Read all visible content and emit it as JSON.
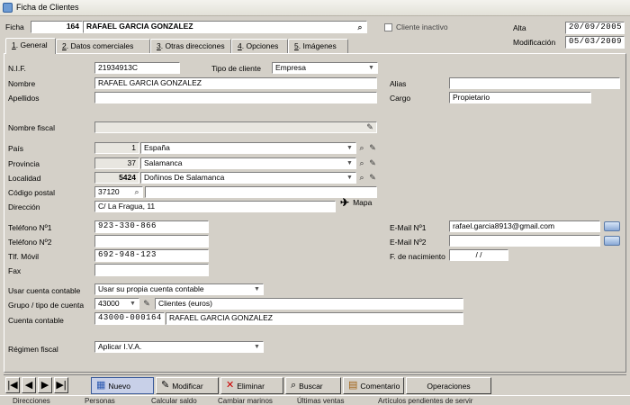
{
  "window": {
    "title": "Ficha de Clientes"
  },
  "header": {
    "ficha_label": "Ficha",
    "ficha_number": "164",
    "client_name": "RAFAEL GARCIA GONZALEZ",
    "inactive_label": "Cliente inactivo",
    "alta_label": "Alta",
    "alta_value": "20/09/2005",
    "modificacion_label": "Modificación",
    "modificacion_value": "05/03/2009"
  },
  "tabs": [
    {
      "key": "1",
      "label": ". General"
    },
    {
      "key": "2",
      "label": ". Datos comerciales"
    },
    {
      "key": "3",
      "label": ". Otras direcciones"
    },
    {
      "key": "4",
      "label": ". Opciones"
    },
    {
      "key": "5",
      "label": ". Imágenes"
    }
  ],
  "form": {
    "nif_label": "N.I.F.",
    "nif": "21934913C",
    "tipo_label": "Tipo de cliente",
    "tipo": "Empresa",
    "nombre_label": "Nombre",
    "nombre": "RAFAEL GARCIA GONZALEZ",
    "alias_label": "Alias",
    "alias": "",
    "apellidos_label": "Apellidos",
    "apellidos": "",
    "cargo_label": "Cargo",
    "cargo": "Propietario",
    "nombre_fiscal_label": "Nombre fiscal",
    "nombre_fiscal": "",
    "pais_label": "País",
    "pais_code": "1",
    "pais": "España",
    "provincia_label": "Provincia",
    "provincia_code": "37",
    "provincia": "Salamanca",
    "localidad_label": "Localidad",
    "localidad_code": "5424",
    "localidad": "Doñinos De Salamanca",
    "cp_label": "Código postal",
    "cp": "37120",
    "cp_extra": "",
    "direccion_label": "Dirección",
    "direccion": "C/ La Fragua, 11",
    "mapa_label": "Mapa",
    "tel1_label": "Teléfono Nº1",
    "tel1": "923-330-866",
    "tel2_label": "Teléfono Nº2",
    "tel2": "",
    "movil_label": "Tlf. Móvil",
    "movil": "692-948-123",
    "fax_label": "Fax",
    "fax": "",
    "email1_label": "E-Mail Nº1",
    "email1": "rafael.garcia8913@gmail.com",
    "email2_label": "E-Mail Nº2",
    "email2": "",
    "nacimiento_label": "F. de nacimiento",
    "nacimiento": "/    /",
    "cuenta_uso_label": "Usar cuenta contable",
    "cuenta_uso": "Usar su propia cuenta contable",
    "grupo_label": "Grupo / tipo de cuenta",
    "grupo_code": "43000",
    "grupo_desc": "Clientes (euros)",
    "cuenta_label": "Cuenta contable",
    "cuenta_code": "43000-000164",
    "cuenta_desc": "RAFAEL GARCIA GONZALEZ",
    "regimen_label": "Régimen fiscal",
    "regimen": "Aplicar I.V.A."
  },
  "toolbar": {
    "nuevo": "Nuevo",
    "modificar": "Modificar",
    "eliminar": "Eliminar",
    "buscar": "Buscar",
    "comentario": "Comentario",
    "operaciones": "Operaciones"
  },
  "bottom": {
    "item1": "Direcciones",
    "item2": "Personas",
    "item3": "Calcular saldo",
    "item4": "Cambiar marinos",
    "item5": "Últimas ventas",
    "item6": "Artículos pendientes de servir"
  }
}
